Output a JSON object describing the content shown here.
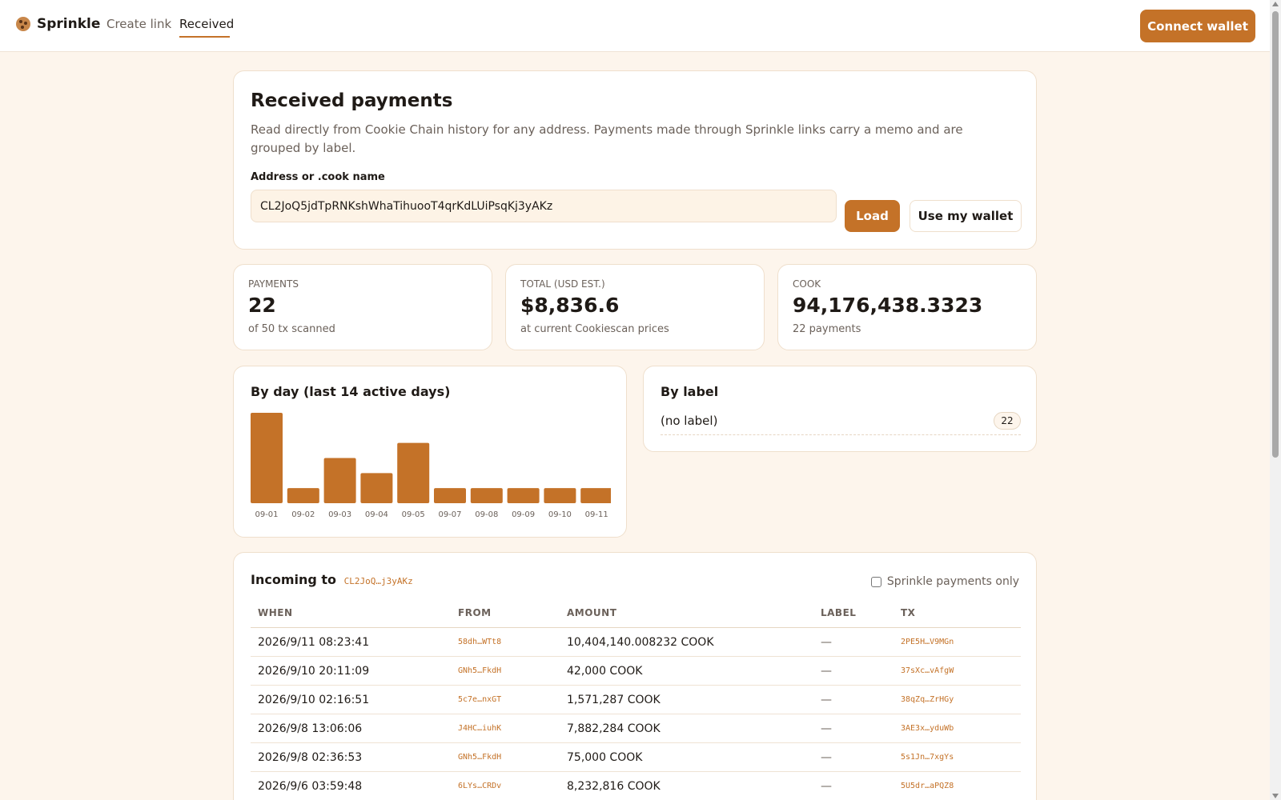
{
  "nav": {
    "brand": "Sprinkle",
    "create_link": "Create link",
    "received": "Received",
    "connect_wallet": "Connect wallet"
  },
  "hero": {
    "title": "Received payments",
    "description": "Read directly from Cookie Chain history for any address. Payments made through Sprinkle links carry a memo and are grouped by label.",
    "address_label": "Address or .cook name",
    "address_value": "CL2JoQ5jdTpRNKshWhaTihuooT4qrKdLUiPsqKj3yAKz",
    "load_button": "Load",
    "wallet_button": "Use my wallet"
  },
  "stats": [
    {
      "label": "PAYMENTS",
      "value": "22",
      "sub": "of 50 tx scanned"
    },
    {
      "label": "TOTAL (USD EST.)",
      "value": "$8,836.6",
      "sub": "at current Cookiescan prices"
    },
    {
      "label": "COOK",
      "value": "94,176,438.3323",
      "sub": "22 payments"
    }
  ],
  "by_day_title": "By day (last 14 active days)",
  "chart_data": {
    "type": "bar",
    "categories": [
      "09-01",
      "09-02",
      "09-03",
      "09-04",
      "09-05",
      "09-07",
      "09-08",
      "09-09",
      "09-10",
      "09-11"
    ],
    "values": [
      6,
      1,
      3,
      2,
      4,
      1,
      1,
      1,
      1,
      1
    ],
    "bar_color": "#c47228",
    "title": "By day (last 14 active days)"
  },
  "by_label": {
    "title": "By label",
    "rows": [
      {
        "name": "(no label)",
        "count": "22"
      }
    ]
  },
  "incoming": {
    "title": "Incoming to",
    "address_short": "CL2JoQ…j3yAKz",
    "filter_label": "Sprinkle payments only",
    "columns": [
      "WHEN",
      "FROM",
      "AMOUNT",
      "LABEL",
      "TX"
    ],
    "rows": [
      {
        "when": "2026/9/11 08:23:41",
        "from": "58dh…WTt8",
        "amount": "10,404,140.008232 COOK",
        "label": "—",
        "tx": "2PE5H…V9MGn"
      },
      {
        "when": "2026/9/10 20:11:09",
        "from": "GNh5…FkdH",
        "amount": "42,000 COOK",
        "label": "—",
        "tx": "37sXc…vAfgW"
      },
      {
        "when": "2026/9/10 02:16:51",
        "from": "5c7e…nxGT",
        "amount": "1,571,287 COOK",
        "label": "—",
        "tx": "38qZq…ZrHGy"
      },
      {
        "when": "2026/9/8 13:06:06",
        "from": "J4HC…iuhK",
        "amount": "7,882,284 COOK",
        "label": "—",
        "tx": "3AE3x…yduWb"
      },
      {
        "when": "2026/9/8 02:36:53",
        "from": "GNh5…FkdH",
        "amount": "75,000 COOK",
        "label": "—",
        "tx": "5s1Jn…7xgYs"
      },
      {
        "when": "2026/9/6 03:59:48",
        "from": "6LYs…CRDv",
        "amount": "8,232,816 COOK",
        "label": "—",
        "tx": "5U5dr…aPQZ8"
      }
    ]
  },
  "accent_color": "#c47228"
}
